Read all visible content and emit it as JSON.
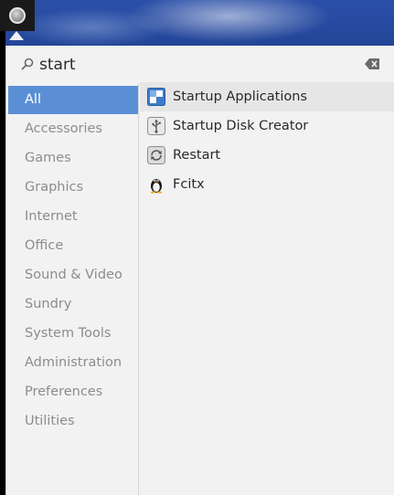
{
  "menu_button": {
    "icon": "menu-ring-icon"
  },
  "search": {
    "value": "start",
    "icon": "search-icon",
    "clear_icon": "clear-icon"
  },
  "categories": [
    {
      "label": "All",
      "selected": true
    },
    {
      "label": "Accessories"
    },
    {
      "label": "Games"
    },
    {
      "label": "Graphics"
    },
    {
      "label": "Internet"
    },
    {
      "label": "Office"
    },
    {
      "label": "Sound & Video"
    },
    {
      "label": "Sundry"
    },
    {
      "label": "System Tools"
    },
    {
      "label": "Administration"
    },
    {
      "label": "Preferences"
    },
    {
      "label": "Utilities"
    }
  ],
  "results": [
    {
      "label": "Startup Applications",
      "icon": "startup-applications-icon",
      "hovered": true
    },
    {
      "label": "Startup Disk Creator",
      "icon": "usb-disk-icon"
    },
    {
      "label": "Restart",
      "icon": "restart-icon"
    },
    {
      "label": "Fcitx",
      "icon": "penguin-icon"
    }
  ],
  "colors": {
    "selected_bg": "#5a8fd6",
    "panel_bg": "#f2f2f2",
    "hover_bg": "#e6e6e6"
  }
}
